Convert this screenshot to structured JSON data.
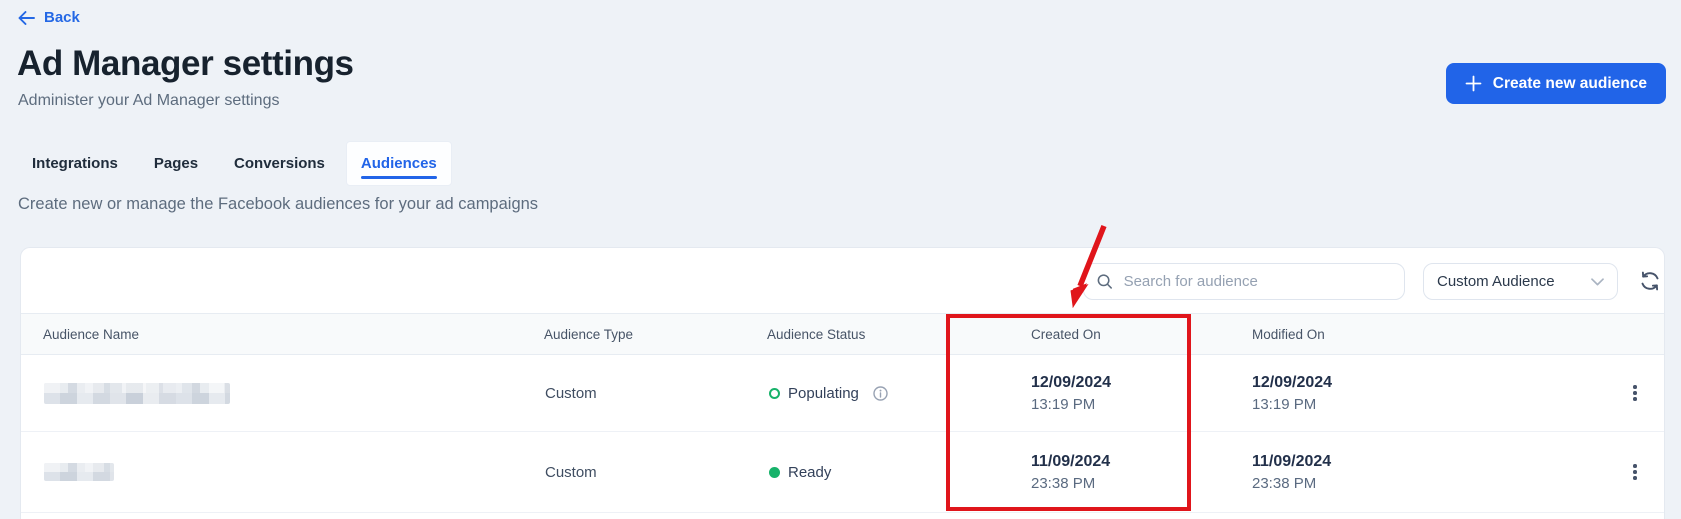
{
  "header": {
    "back_label": "Back",
    "title": "Ad Manager settings",
    "subtitle": "Administer your Ad Manager settings",
    "create_button_label": "Create new audience"
  },
  "tabs": [
    {
      "label": "Integrations",
      "active": false
    },
    {
      "label": "Pages",
      "active": false
    },
    {
      "label": "Conversions",
      "active": false
    },
    {
      "label": "Audiences",
      "active": true
    }
  ],
  "description": "Create new or manage the Facebook audiences for your ad campaigns",
  "toolbar": {
    "search_placeholder": "Search for audience",
    "audience_type_filter": "Custom Audience"
  },
  "table": {
    "columns": {
      "name": "Audience Name",
      "type": "Audience Type",
      "status": "Audience Status",
      "created": "Created On",
      "modified": "Modified On"
    },
    "rows": [
      {
        "name": "",
        "name_redacted": true,
        "type": "Custom",
        "status": "Populating",
        "status_kind": "populating",
        "has_info_icon": true,
        "created_date": "12/09/2024",
        "created_time": "13:19 PM",
        "modified_date": "12/09/2024",
        "modified_time": "13:19 PM"
      },
      {
        "name": "",
        "name_redacted": true,
        "type": "Custom",
        "status": "Ready",
        "status_kind": "ready",
        "has_info_icon": false,
        "created_date": "11/09/2024",
        "created_time": "23:38 PM",
        "modified_date": "11/09/2024",
        "modified_time": "23:38 PM"
      }
    ]
  },
  "annotation": {
    "type": "red rectangle with arrow",
    "highlighted_column": "Created On",
    "color": "#e0151b"
  },
  "colors": {
    "accent_blue": "#2164e8",
    "status_green": "#17b26a",
    "annotation_red": "#e0151b",
    "page_background": "#eef2f7"
  }
}
